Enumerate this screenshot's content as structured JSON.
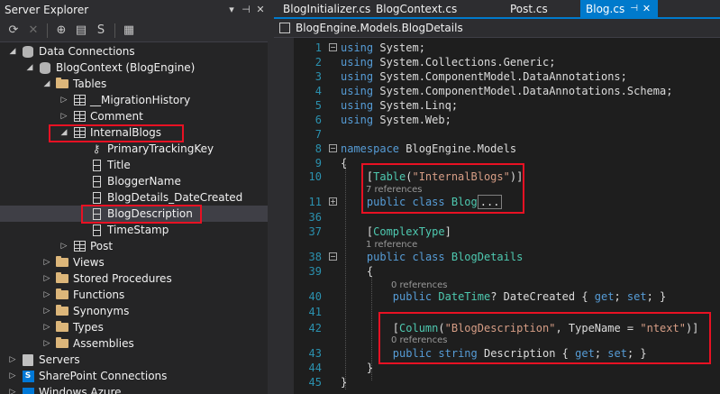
{
  "server_explorer": {
    "title": "Server Explorer",
    "title_buttons": [
      "▾",
      "⊣",
      "✕"
    ],
    "tree": [
      {
        "label": "Data Connections",
        "icon": "database-icon",
        "arrow": "◢"
      },
      {
        "label": "BlogContext (BlogEngine)",
        "icon": "connection-icon",
        "arrow": "◢"
      },
      {
        "label": "Tables",
        "icon": "folder-icon",
        "arrow": "◢"
      },
      {
        "label": "__MigrationHistory",
        "icon": "table-icon",
        "arrow": "▷"
      },
      {
        "label": "Comment",
        "icon": "table-icon",
        "arrow": "▷"
      },
      {
        "label": "InternalBlogs",
        "icon": "table-icon",
        "arrow": "◢"
      },
      {
        "label": "PrimaryTrackingKey",
        "icon": "key-icon",
        "arrow": ""
      },
      {
        "label": "Title",
        "icon": "column-icon",
        "arrow": ""
      },
      {
        "label": "BloggerName",
        "icon": "column-icon",
        "arrow": ""
      },
      {
        "label": "BlogDetails_DateCreated",
        "icon": "column-icon",
        "arrow": ""
      },
      {
        "label": "BlogDescription",
        "icon": "column-icon",
        "arrow": "",
        "selected": true
      },
      {
        "label": "TimeStamp",
        "icon": "column-icon",
        "arrow": ""
      },
      {
        "label": "Post",
        "icon": "table-icon",
        "arrow": "▷"
      },
      {
        "label": "Views",
        "icon": "folder-icon",
        "arrow": "▷"
      },
      {
        "label": "Stored Procedures",
        "icon": "folder-icon",
        "arrow": "▷"
      },
      {
        "label": "Functions",
        "icon": "folder-icon",
        "arrow": "▷"
      },
      {
        "label": "Synonyms",
        "icon": "folder-icon",
        "arrow": "▷"
      },
      {
        "label": "Types",
        "icon": "folder-icon",
        "arrow": "▷"
      },
      {
        "label": "Assemblies",
        "icon": "folder-icon",
        "arrow": "▷"
      },
      {
        "label": "Servers",
        "icon": "server-icon",
        "arrow": "▷"
      },
      {
        "label": "SharePoint Connections",
        "icon": "sharepoint-icon",
        "arrow": "▷"
      },
      {
        "label": "Windows Azure",
        "icon": "azure-icon",
        "arrow": "▷"
      }
    ]
  },
  "editor": {
    "tabs": [
      {
        "label": "BlogInitializer.cs"
      },
      {
        "label": "BlogContext.cs"
      },
      {
        "label": "Post.cs"
      },
      {
        "label": "Blog.cs",
        "active": true
      }
    ],
    "navigation": "BlogEngine.Models.BlogDetails",
    "lines": [
      {
        "n": "1",
        "fold": "−",
        "segs": [
          {
            "t": "using",
            "c": "kw"
          },
          {
            "t": " System;"
          }
        ]
      },
      {
        "n": "2",
        "segs": [
          {
            "t": "using",
            "c": "kw"
          },
          {
            "t": " System.Collections.Generic;"
          }
        ]
      },
      {
        "n": "3",
        "segs": [
          {
            "t": "using",
            "c": "kw"
          },
          {
            "t": " System.ComponentModel.DataAnnotations;"
          }
        ]
      },
      {
        "n": "4",
        "segs": [
          {
            "t": "using",
            "c": "kw"
          },
          {
            "t": " System.ComponentModel.DataAnnotations.Schema;"
          }
        ]
      },
      {
        "n": "5",
        "segs": [
          {
            "t": "using",
            "c": "kw"
          },
          {
            "t": " System.Linq;"
          }
        ]
      },
      {
        "n": "6",
        "segs": [
          {
            "t": "using",
            "c": "kw"
          },
          {
            "t": " System.Web;"
          }
        ]
      },
      {
        "n": "7",
        "segs": []
      },
      {
        "n": "8",
        "fold": "−",
        "segs": [
          {
            "t": "namespace",
            "c": "kw"
          },
          {
            "t": " BlogEngine.Models"
          }
        ]
      },
      {
        "n": "9",
        "segs": [
          {
            "t": "{"
          }
        ]
      },
      {
        "n": "10",
        "segs": [
          {
            "t": "    ["
          },
          {
            "t": "Table",
            "c": "ty"
          },
          {
            "t": "("
          },
          {
            "t": "\"InternalBlogs\"",
            "c": "st"
          },
          {
            "t": ")]"
          }
        ]
      },
      {
        "n": "11",
        "fold": "+",
        "segs": [
          {
            "t": "    "
          },
          {
            "t": "public",
            "c": "kw"
          },
          {
            "t": " "
          },
          {
            "t": "class",
            "c": "kw"
          },
          {
            "t": " "
          },
          {
            "t": "Blog",
            "c": "ty"
          }
        ]
      },
      {
        "n": "36",
        "segs": []
      },
      {
        "n": "37",
        "segs": [
          {
            "t": "    ["
          },
          {
            "t": "ComplexType",
            "c": "ty"
          },
          {
            "t": "]"
          }
        ]
      },
      {
        "n": "38",
        "fold": "−",
        "segs": [
          {
            "t": "    "
          },
          {
            "t": "public",
            "c": "kw"
          },
          {
            "t": " "
          },
          {
            "t": "class",
            "c": "kw"
          },
          {
            "t": " "
          },
          {
            "t": "BlogDetails",
            "c": "ty"
          }
        ]
      },
      {
        "n": "39",
        "segs": [
          {
            "t": "    {"
          }
        ]
      },
      {
        "n": "40",
        "segs": [
          {
            "t": "        "
          },
          {
            "t": "public",
            "c": "kw"
          },
          {
            "t": " "
          },
          {
            "t": "DateTime",
            "c": "ty"
          },
          {
            "t": "? DateCreated { "
          },
          {
            "t": "get",
            "c": "kw"
          },
          {
            "t": "; "
          },
          {
            "t": "set",
            "c": "kw"
          },
          {
            "t": "; }"
          }
        ]
      },
      {
        "n": "41",
        "segs": []
      },
      {
        "n": "42",
        "segs": [
          {
            "t": "        ["
          },
          {
            "t": "Column",
            "c": "ty"
          },
          {
            "t": "("
          },
          {
            "t": "\"BlogDescription\"",
            "c": "st"
          },
          {
            "t": ", TypeName = "
          },
          {
            "t": "\"ntext\"",
            "c": "st"
          },
          {
            "t": ")]"
          }
        ]
      },
      {
        "n": "43",
        "segs": [
          {
            "t": "        "
          },
          {
            "t": "public",
            "c": "kw"
          },
          {
            "t": " "
          },
          {
            "t": "string",
            "c": "kw"
          },
          {
            "t": " Description { "
          },
          {
            "t": "get",
            "c": "kw"
          },
          {
            "t": "; "
          },
          {
            "t": "set",
            "c": "kw"
          },
          {
            "t": "; }"
          }
        ]
      },
      {
        "n": "44",
        "segs": [
          {
            "t": "    }"
          }
        ]
      },
      {
        "n": "45",
        "segs": [
          {
            "t": "}"
          }
        ]
      }
    ],
    "collapsed_text": "...",
    "references": [
      {
        "text": "7 references"
      },
      {
        "text": "1 reference"
      },
      {
        "text": "0 references"
      },
      {
        "text": "0 references"
      }
    ]
  },
  "colors": {
    "accent": "#007acc",
    "highlight_box": "#e81123",
    "keyword": "#569cd6",
    "type": "#4ec9b0",
    "string": "#d69d85",
    "line_number": "#2b91af"
  }
}
